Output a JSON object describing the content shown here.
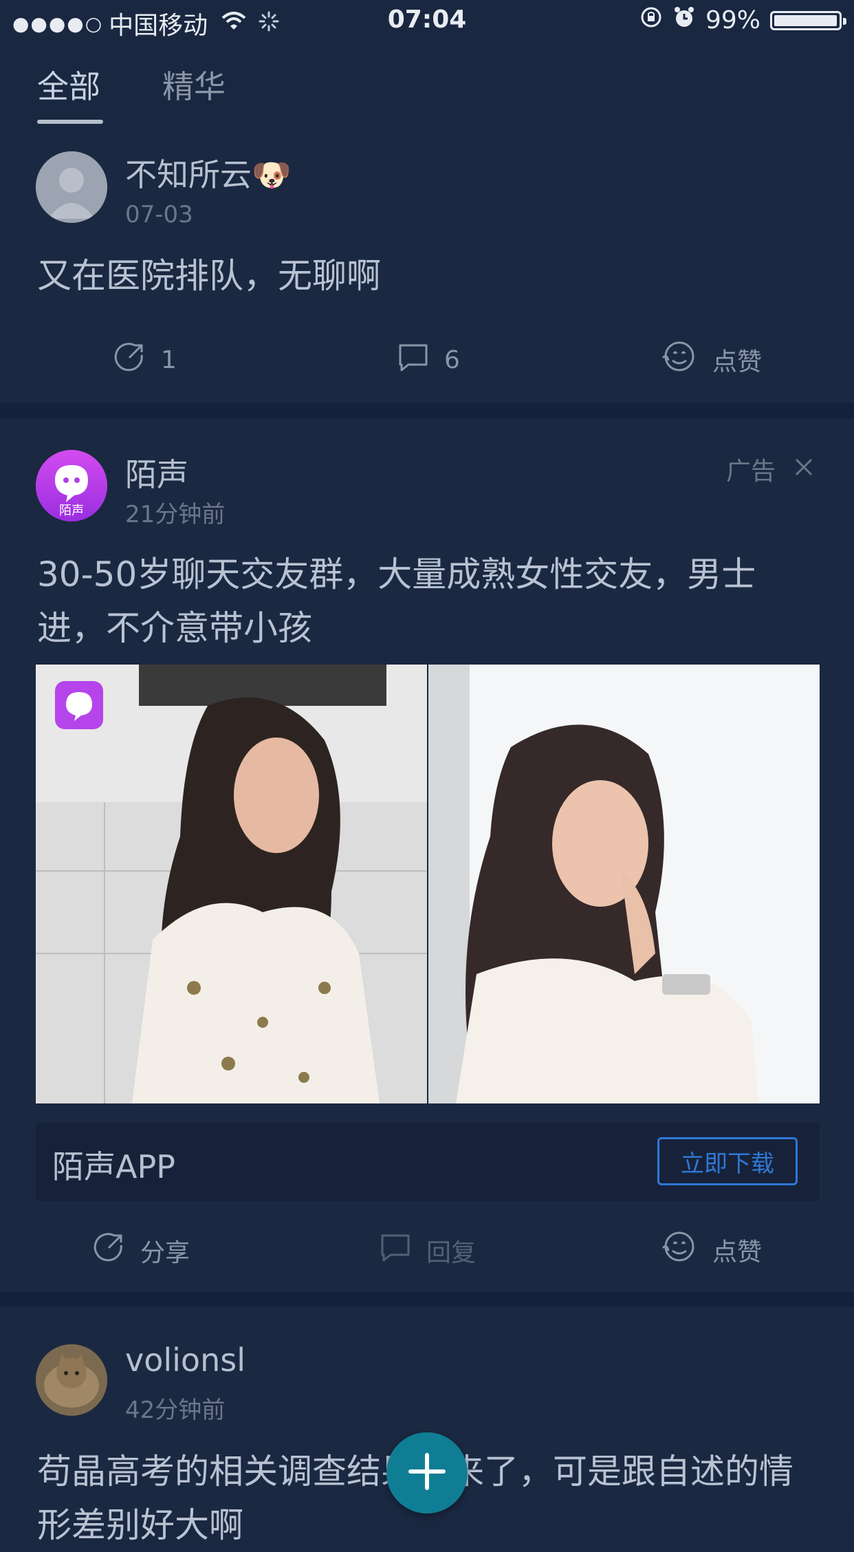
{
  "status_bar": {
    "signal": "●●●●○",
    "carrier": "中国移动",
    "time": "07:04",
    "battery": "99%",
    "battery_level": 0.99
  },
  "tabs": [
    {
      "label": "全部",
      "active": true
    },
    {
      "label": "精华",
      "active": false
    }
  ],
  "posts": [
    {
      "username": "不知所云🐶",
      "time": "07-03",
      "content": "又在医院排队，无聊啊",
      "actions": {
        "share": "1",
        "reply": "6",
        "like": "点赞"
      }
    },
    {
      "username": "陌声",
      "avatar_text": "陌声",
      "time": "21分钟前",
      "ad_label": "广告",
      "content": "30-50岁聊天交友群，大量成熟女性交友，男士进，不介意带小孩",
      "app_name": "陌声APP",
      "download_label": "立即下载",
      "actions": {
        "share": "分享",
        "reply": "回复",
        "like": "点赞"
      }
    },
    {
      "username": "volionsl",
      "time": "42分钟前",
      "content": "苟晶高考的相关调查结果出来了，可是跟自述的情形差别好大啊"
    }
  ],
  "colors": {
    "background": "#1a2740",
    "accent_blue": "#2f78d6",
    "fab": "#0f7e95"
  }
}
